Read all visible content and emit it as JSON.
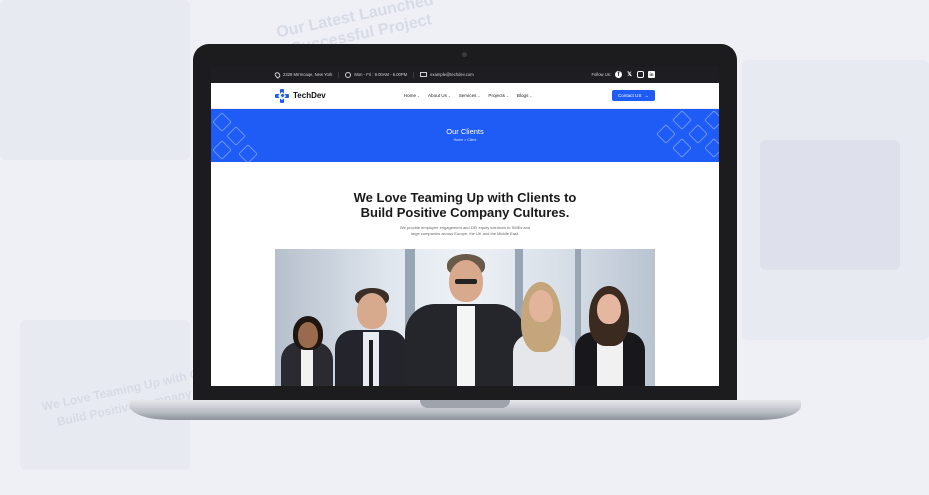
{
  "background_text": {
    "top": "Our Latest Launched",
    "top2": "Successful Project",
    "bottom": "We Love Teaming Up with Clients",
    "bottom2": "Build Positive Company Culture"
  },
  "topbar": {
    "address": "2328 Mrrmcaqe, New York",
    "hours": "Mon - Fri : 9.00AM - 6.00PM",
    "email": "example@techdev.com",
    "follow_label": "Follow Us:",
    "social": [
      "facebook-icon",
      "x-icon",
      "instagram-icon",
      "linkedin-icon"
    ]
  },
  "nav": {
    "brand": "TechDev",
    "menu": [
      "Home",
      "About Us",
      "Services",
      "Projects",
      "Blogs"
    ],
    "cta": "Contact US"
  },
  "hero": {
    "title": "Our Clients",
    "breadcrumb": "Home > Client"
  },
  "content": {
    "headline_line1": "We Love Teaming Up with Clients to",
    "headline_line2": "Build Positive Company Cultures.",
    "sub_line1": "We provide employee engagement and DEI equity solutions to SMEs and",
    "sub_line2": "large companies across Europe, the UK and the Middle East."
  },
  "colors": {
    "accent": "#1f5cf5",
    "topbar": "#1e1e22",
    "page_bg": "#eef0f6"
  }
}
